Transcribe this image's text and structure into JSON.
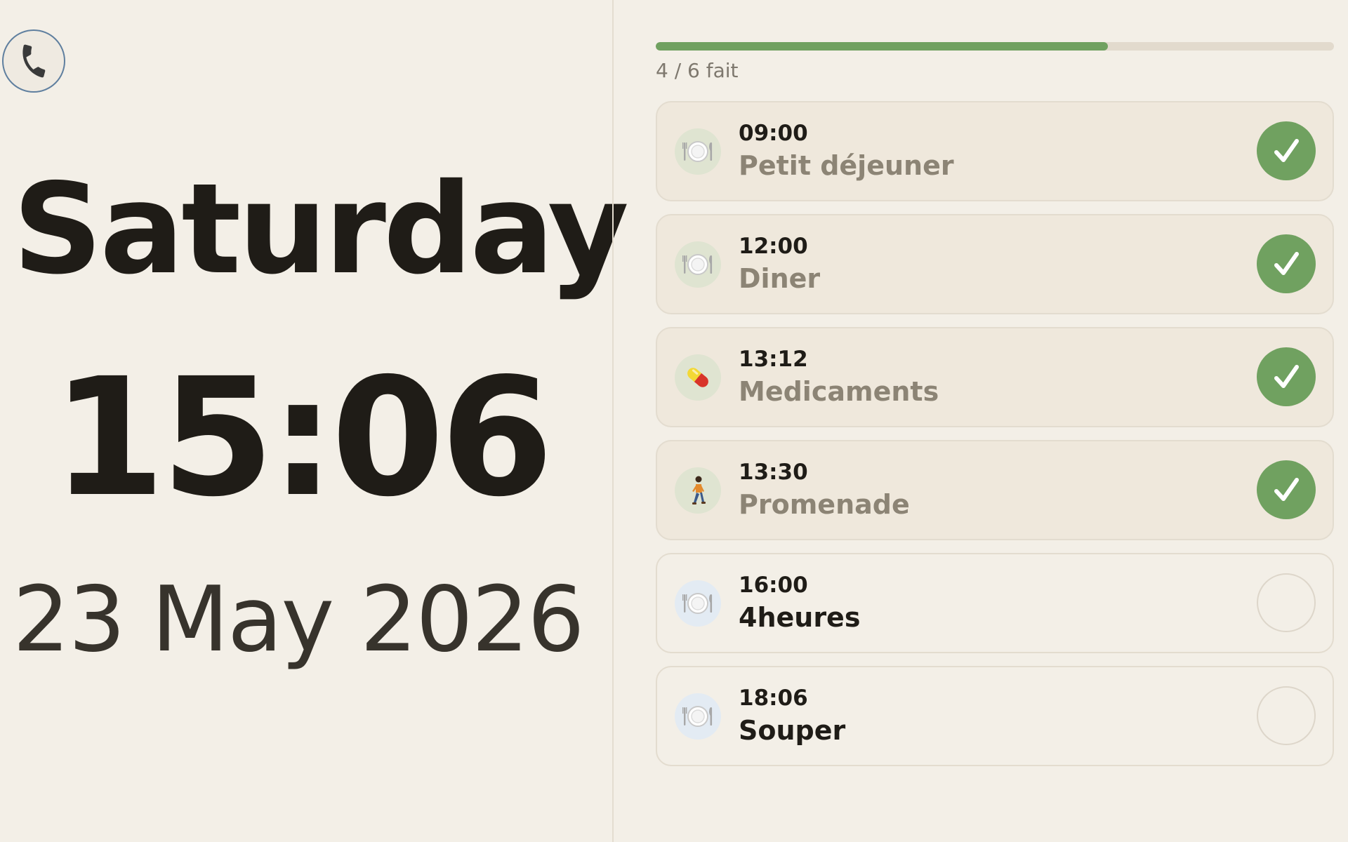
{
  "clock": {
    "day": "Saturday",
    "time": "15:06",
    "date": "23 May 2026"
  },
  "call_button": {
    "icon": "phone-icon"
  },
  "progress": {
    "done": 4,
    "total": 6,
    "label": "4 / 6 fait",
    "fraction": 0.667
  },
  "tasks": [
    {
      "time": "09:00",
      "name": "Petit déjeuner",
      "icon": "plate-cutlery-icon",
      "done": true
    },
    {
      "time": "12:00",
      "name": "Diner",
      "icon": "plate-cutlery-icon",
      "done": true
    },
    {
      "time": "13:12",
      "name": "Medicaments",
      "icon": "pill-icon",
      "done": true
    },
    {
      "time": "13:30",
      "name": "Promenade",
      "icon": "walking-person-icon",
      "done": true
    },
    {
      "time": "16:00",
      "name": "4heures",
      "icon": "plate-cutlery-icon",
      "done": false
    },
    {
      "time": "18:06",
      "name": "Souper",
      "icon": "plate-cutlery-icon",
      "done": false
    }
  ],
  "colors": {
    "background": "#f3efe7",
    "accent_green": "#70a160",
    "progress_track": "#e2dacd",
    "done_card": "#efe8dc",
    "call_button_border": "#5f7f9f"
  }
}
